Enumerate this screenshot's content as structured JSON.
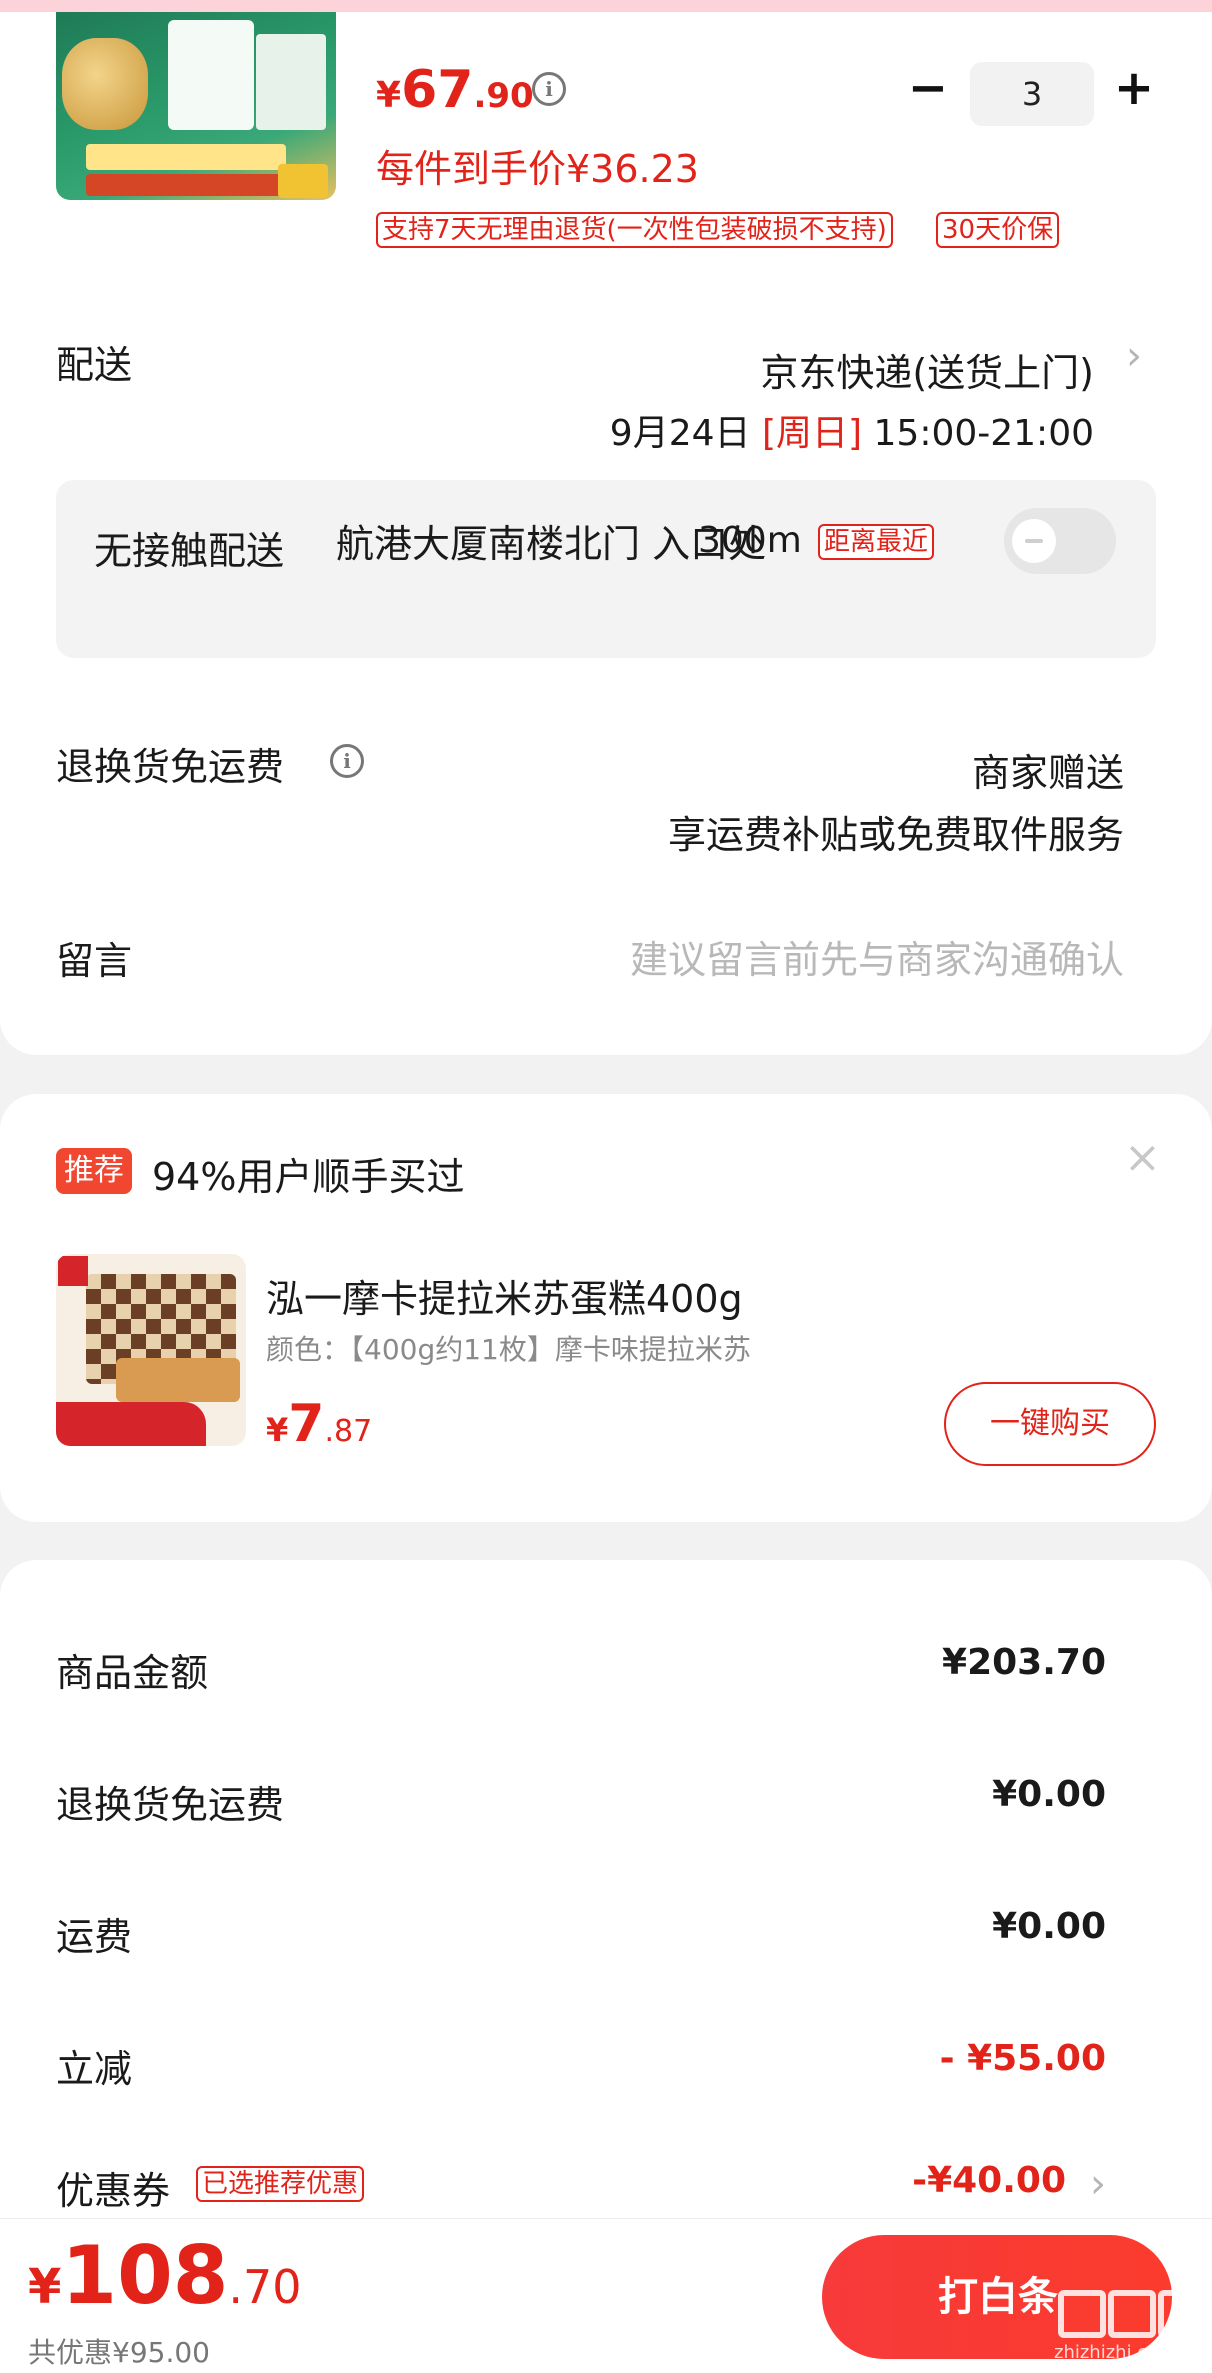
{
  "product": {
    "price_currency": "¥",
    "price_int": "67",
    "price_dec": ".90",
    "quantity": "3",
    "qty_minus": "−",
    "qty_plus": "+",
    "unit_price": "每件到手价¥36.23",
    "return_badge": "支持7天无理由退货(一次性包装破损不支持)",
    "price_protect_badge": "30天价保",
    "info_icon": "info-icon"
  },
  "delivery": {
    "label": "配送",
    "method": "京东快递(送货上门)",
    "date": "9月24日",
    "weekday": "[周日]",
    "time": "15:00-21:00"
  },
  "contactless": {
    "label": "无接触配送",
    "address": "航港大厦南楼北门 入口处",
    "distance": "300m",
    "nearest_badge": "距离最近",
    "enabled": false
  },
  "return_shipping": {
    "label": "退换货免运费",
    "line1": "商家赠送",
    "line2": "享运费补贴或免费取件服务"
  },
  "message": {
    "label": "留言",
    "placeholder": "建议留言前先与商家沟通确认"
  },
  "recommend": {
    "tag": "推荐",
    "title": "94%用户顺手买过",
    "close": "×",
    "name": "泓一摩卡提拉米苏蛋糕400g",
    "spec": "颜色：【400g约11枚】摩卡味提拉米苏",
    "price_currency": "¥",
    "price_int": "7",
    "price_dec": ".87",
    "buy_button": "一键购买"
  },
  "summary": {
    "rows": [
      {
        "label": "商品金额",
        "value": "¥203.70"
      },
      {
        "label": "退换货免运费",
        "value": "¥0.00"
      },
      {
        "label": "运费",
        "value": "¥0.00"
      },
      {
        "label": "立减",
        "value": "- ¥55.00"
      },
      {
        "label": "优惠券",
        "value": "-¥40.00",
        "badge": "已选推荐优惠"
      }
    ]
  },
  "footer": {
    "total_currency": "¥",
    "total_int": "108",
    "total_dec": ".70",
    "saved": "共优惠¥95.00",
    "pay_button": "打白条"
  },
  "watermark": {
    "text": "zhizhizhi.com"
  },
  "colors": {
    "accent": "#e2231a",
    "pay_button": "#f73a3a",
    "background": "#f2f2f2"
  }
}
